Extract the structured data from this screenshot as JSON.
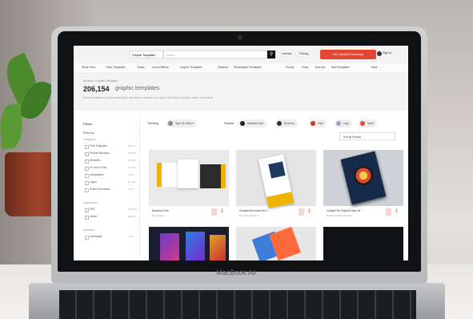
{
  "laptop": {
    "brand": "MacBook Air"
  },
  "header": {
    "category_select": "Graphic Templates",
    "search_placeholder": "Search",
    "links": [
      "License",
      "Pricing"
    ],
    "cta": "Get Unlimited Downloads",
    "signin": "Sign In"
  },
  "category_nav": [
    "Stock Video",
    "Video Templates",
    "Music",
    "Sound Effects",
    "Graphic Templates",
    "Graphics",
    "Presentation Templates",
    "Photos",
    "Fonts",
    "Add-ons",
    "Web Templates",
    "More"
  ],
  "hero": {
    "breadcrumb": "All Items / Graphic Templates",
    "count": "206,154",
    "count_label": "graphic templates",
    "description": "Discover millions of professional flyers, brochures, mockups and more. With fresh templates added every week."
  },
  "sidebar": {
    "filters_label": "Filters",
    "refine_label": "Refine by",
    "categories_label": "Categories",
    "categories": [
      {
        "label": "Print Templates",
        "count": "89,314"
      },
      {
        "label": "Product Mockups",
        "count": "33,893"
      },
      {
        "label": "Websites",
        "count": "29,185"
      },
      {
        "label": "UX and UI Kits",
        "count": "19,065"
      },
      {
        "label": "Infographics",
        "count": "6,908"
      },
      {
        "label": "Logos",
        "count": "21,740"
      },
      {
        "label": "Scene Generators",
        "count": "5,318"
      }
    ],
    "applications_label": "Applications",
    "applications": [
      {
        "label": "PSD",
        "count": "132,114"
      },
      {
        "label": "Adobe",
        "count": "98,214"
      }
    ],
    "attributes_label": "Attributes",
    "attributes": [
      {
        "label": "Landscape",
        "count": "7,901"
      }
    ]
  },
  "trending": {
    "label": "Trending",
    "pill": "Spec ID Carbon",
    "popular_label": "Popular",
    "popular_pills": [
      "Business card",
      "Brochure",
      "Flyer",
      "Logo",
      "Sport"
    ]
  },
  "sort_label": "Sort by Popular",
  "cards": [
    {
      "title": "Business Plan",
      "author": "By ingoprint"
    },
    {
      "title": "Creative Brochure Vol.3",
      "author": "By ambergraphics"
    },
    {
      "title": "Crystal Fire Graphic Flyer Kit",
      "author": "By ElementMeTemplate"
    }
  ],
  "colors": {
    "accent": "#e5462f",
    "search_button": "#111111"
  }
}
